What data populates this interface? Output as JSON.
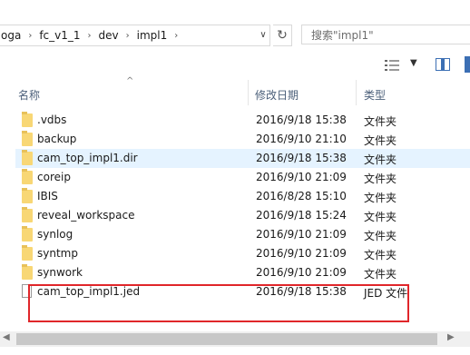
{
  "breadcrumb": [
    "oga",
    "fc_v1_1",
    "dev",
    "impl1"
  ],
  "search": {
    "placeholder": "搜索\"impl1\""
  },
  "columns": {
    "name": "名称",
    "date": "修改日期",
    "type": "类型"
  },
  "files": [
    {
      "name": ".vdbs",
      "date": "2016/9/18 15:38",
      "type": "文件夹",
      "kind": "folder"
    },
    {
      "name": "backup",
      "date": "2016/9/10 21:10",
      "type": "文件夹",
      "kind": "folder"
    },
    {
      "name": "cam_top_impl1.dir",
      "date": "2016/9/18 15:38",
      "type": "文件夹",
      "kind": "folder"
    },
    {
      "name": "coreip",
      "date": "2016/9/10 21:09",
      "type": "文件夹",
      "kind": "folder"
    },
    {
      "name": "IBIS",
      "date": "2016/8/28 15:10",
      "type": "文件夹",
      "kind": "folder"
    },
    {
      "name": "reveal_workspace",
      "date": "2016/9/18 15:24",
      "type": "文件夹",
      "kind": "folder"
    },
    {
      "name": "synlog",
      "date": "2016/9/10 21:09",
      "type": "文件夹",
      "kind": "folder"
    },
    {
      "name": "syntmp",
      "date": "2016/9/10 21:09",
      "type": "文件夹",
      "kind": "folder"
    },
    {
      "name": "synwork",
      "date": "2016/9/10 21:09",
      "type": "文件夹",
      "kind": "folder"
    },
    {
      "name": "cam_top_impl1.jed",
      "date": "2016/9/18 15:38",
      "type": "JED 文件",
      "kind": "file"
    }
  ],
  "colors": {
    "highlight_row": "#e5f3ff",
    "annotation_box": "#e0262a",
    "folder": "#f8d775"
  }
}
